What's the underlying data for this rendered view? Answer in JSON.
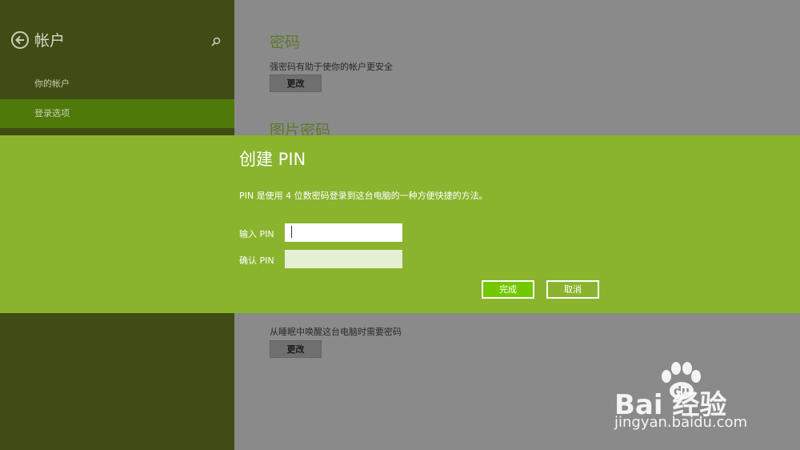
{
  "sidebar": {
    "title": "帐户",
    "items": [
      {
        "label": "你的帐户",
        "selected": false
      },
      {
        "label": "登录选项",
        "selected": true
      }
    ]
  },
  "content": {
    "password_title": "密码",
    "password_desc": "强密码有助于使你的帐户更安全",
    "change_label": "更改",
    "picture_password_title": "图片密码",
    "wake_desc": "从睡眠中唤醒这台电脑时需要密码",
    "wake_change_label": "更改"
  },
  "dialog": {
    "title": "创建 PIN",
    "description": "PIN 是使用 4 位数密码登录到这台电脑的一种方便快捷的方法。",
    "enter_pin_label": "输入 PIN",
    "enter_pin_value": "",
    "confirm_pin_label": "确认 PIN",
    "confirm_pin_value": "",
    "done_label": "完成",
    "cancel_label": "取消"
  },
  "watermark": {
    "brand": "Bai  经验",
    "url": "jingyan.baidu.com"
  },
  "colors": {
    "sidebar_bg": "#3f4d14",
    "sidebar_selected": "#4f7a0a",
    "dialog_bg": "#8ab42e",
    "primary_button": "#74c800",
    "content_bg": "#8a8a8a"
  },
  "icons": [
    "back-arrow-icon",
    "search-icon",
    "baidu-paw-icon"
  ]
}
